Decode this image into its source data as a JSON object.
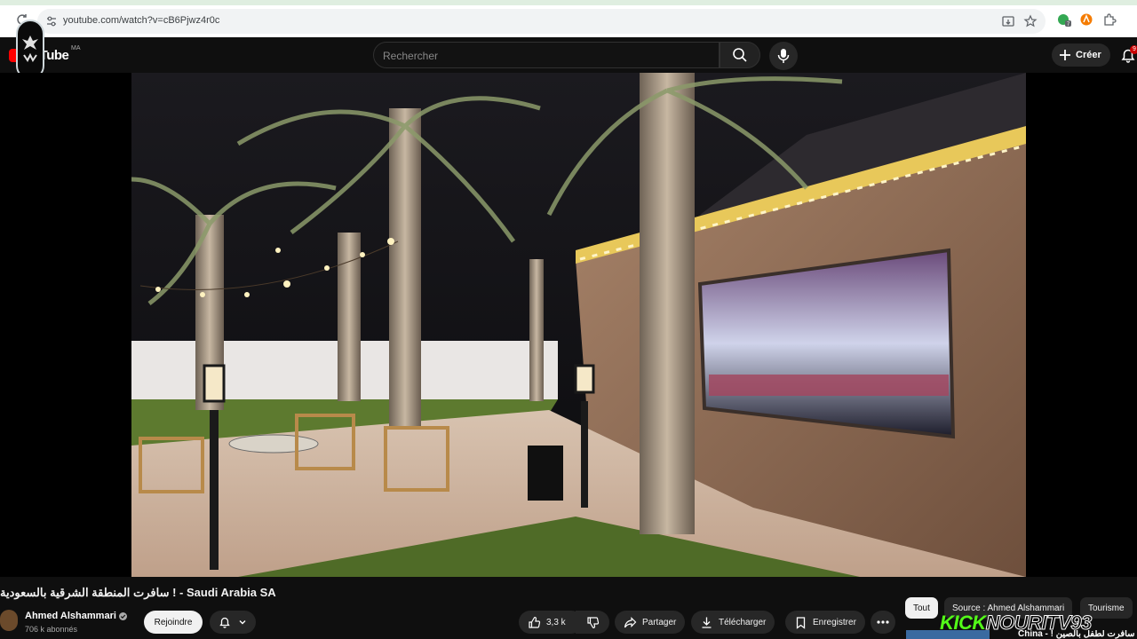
{
  "browser": {
    "url": "youtube.com/watch?v=cB6Pjwz4r0c",
    "extension_badge": "7"
  },
  "header": {
    "logo_text": "uTube",
    "country_code": "MA",
    "search_placeholder": "Rechercher",
    "create_label": "Créer",
    "notification_count": "9"
  },
  "video": {
    "title": "سافرت المنطقة الشرقية بالسعودية ! - Saudi Arabia SA"
  },
  "channel": {
    "name": "Ahmed Alshammari",
    "subscribers": "706 k abonnés",
    "join_label": "Rejoindre"
  },
  "actions": {
    "likes": "3,3 k",
    "share_label": "Partager",
    "download_label": "Télécharger",
    "save_label": "Enregistrer"
  },
  "chips": [
    {
      "label": "Tout",
      "active": true
    },
    {
      "label": "Source : Ahmed Alshammari",
      "active": false
    },
    {
      "label": "Tourisme",
      "active": false
    }
  ],
  "overlay": {
    "kick_label": "KICK",
    "kick_handle": "NOURITV93"
  },
  "recommendation": {
    "partial_title": "China - ! سافرت لطفل بالصين"
  }
}
